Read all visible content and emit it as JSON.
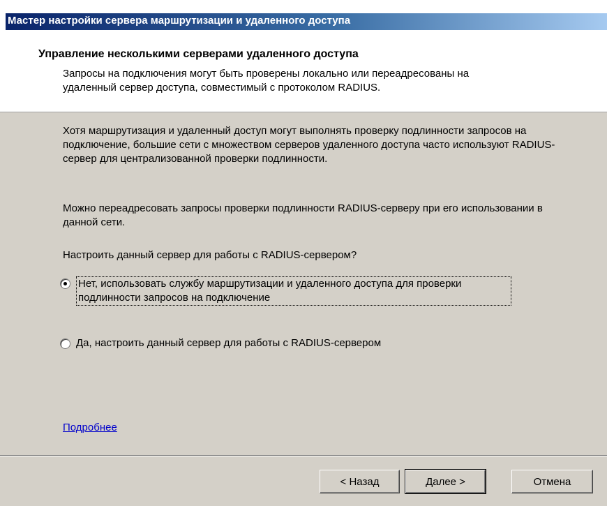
{
  "window": {
    "title": "Мастер настройки сервера маршрутизации и удаленного доступа"
  },
  "header": {
    "title": "Управление несколькими серверами удаленного доступа",
    "subtitle": "Запросы на подключения могут быть проверены локально или переадресованы на удаленный сервер доступа, совместимый с протоколом RADIUS."
  },
  "body": {
    "paragraph1": "Хотя маршрутизация и удаленный доступ могут выполнять проверку подлинности запросов на подключение, большие сети с множеством серверов удаленного доступа часто используют RADIUS-сервер для централизованной проверки подлинности.",
    "paragraph2": "Можно переадресовать запросы проверки подлинности RADIUS-серверу при его использовании в данной сети.",
    "question": "Настроить данный сервер для работы с RADIUS-сервером?",
    "options": [
      {
        "label": "Нет, использовать службу маршрутизации и удаленного доступа для проверки подлинности запросов на подключение",
        "checked": true
      },
      {
        "label": "Да, настроить данный сервер для работы с RADIUS-сервером",
        "checked": false
      }
    ],
    "more_link": "Подробнее"
  },
  "buttons": {
    "back": "< Назад",
    "next": "Далее >",
    "cancel": "Отмена"
  }
}
